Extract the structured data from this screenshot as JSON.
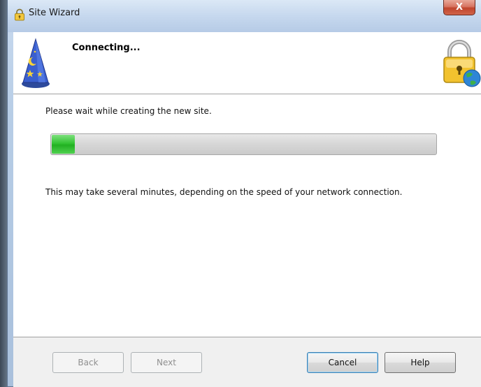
{
  "window": {
    "title": "Site Wizard",
    "close_glyph": "X"
  },
  "header": {
    "title": "Connecting...",
    "left_icon": "wizard-hat-icon",
    "right_icon": "padlock-globe-icon"
  },
  "content": {
    "wait_text": "Please wait while creating the new site.",
    "progress_fraction": 0.06,
    "note_text": "This may take several minutes, depending on the speed of your network connection."
  },
  "buttons": {
    "back": "Back",
    "next": "Next",
    "cancel": "Cancel",
    "help": "Help"
  },
  "colors": {
    "progress_fill": "#33c333",
    "close_button": "#c0452d"
  }
}
